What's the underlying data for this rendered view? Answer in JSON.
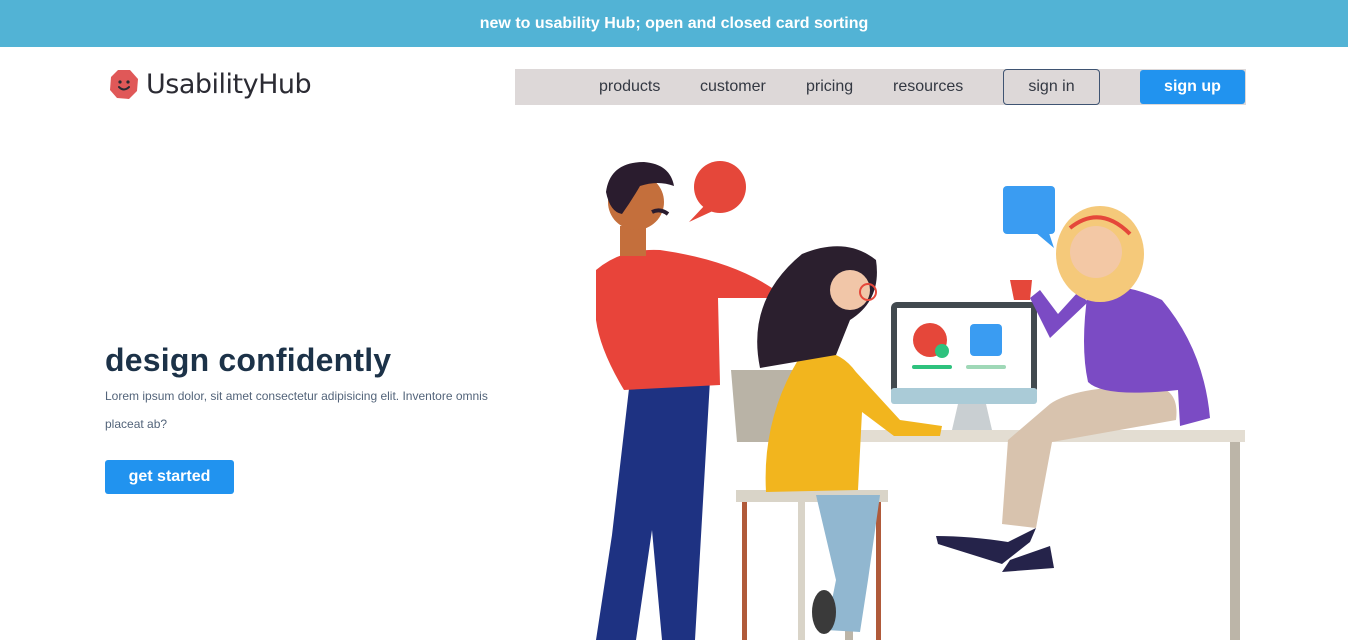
{
  "announcement": "new to usability Hub; open and closed card sorting",
  "brand": {
    "name": "UsabilityHub",
    "icon": "smiling-blob-icon"
  },
  "nav": {
    "links": [
      "products",
      "customer",
      "pricing",
      "resources"
    ],
    "sign_in": "sign in",
    "sign_up": "sign up"
  },
  "hero": {
    "title": "design confidently",
    "body": "Lorem ipsum dolor, sit amet consectetur adipisicing elit. Inventore omnis placeat ab?",
    "cta": "get started"
  },
  "colors": {
    "banner": "#52b3d5",
    "primary": "#2193ef",
    "nav_bg": "#ddd8d8",
    "heading": "#1c3248"
  }
}
